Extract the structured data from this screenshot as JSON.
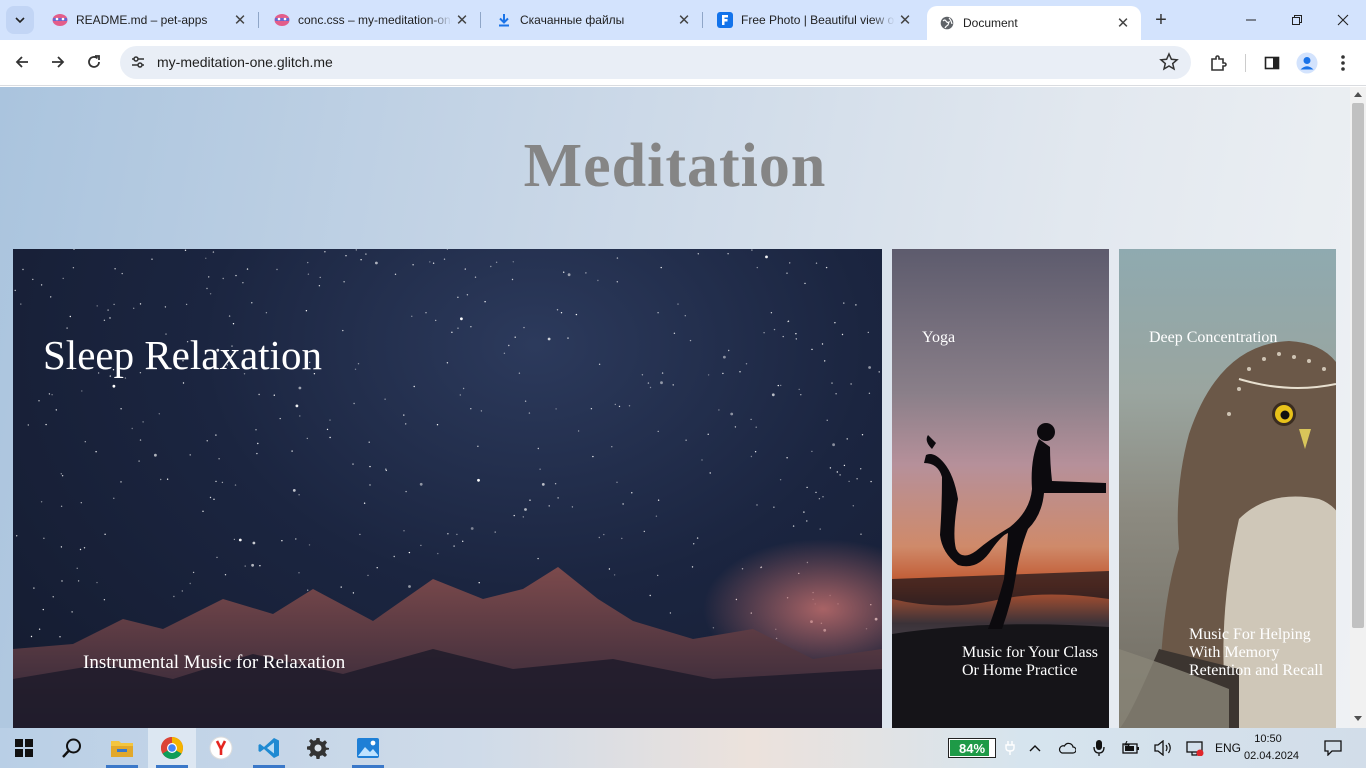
{
  "browser": {
    "tabs": [
      {
        "title": "README.md – pet-apps",
        "icon": "glitch-icon"
      },
      {
        "title": "conc.css – my-meditation-one",
        "icon": "glitch-icon"
      },
      {
        "title": "Скачанные файлы",
        "icon": "download-icon"
      },
      {
        "title": "Free Photo | Beautiful view of ...",
        "icon": "freepik-icon"
      },
      {
        "title": "Document",
        "icon": "globe-icon",
        "active": true
      }
    ],
    "url": "my-meditation-one.glitch.me"
  },
  "page": {
    "heading": "Meditation",
    "cards": [
      {
        "title": "Sleep Relaxation",
        "subtitle": "Instrumental Music for Relaxation"
      },
      {
        "title": "Yoga",
        "subtitle": "Music for Your Class Or Home Practice"
      },
      {
        "title": "Deep Concentration",
        "subtitle": "Music For Helping With Memory Retention and Recall"
      }
    ]
  },
  "taskbar": {
    "battery": "84%",
    "battery_level": 0.84,
    "language": "ENG",
    "time": "10:50",
    "date": "02.04.2024"
  },
  "colors": {
    "tabstrip": "#d3e3fd",
    "heading": "#858585",
    "battery": "#1e9a47"
  }
}
